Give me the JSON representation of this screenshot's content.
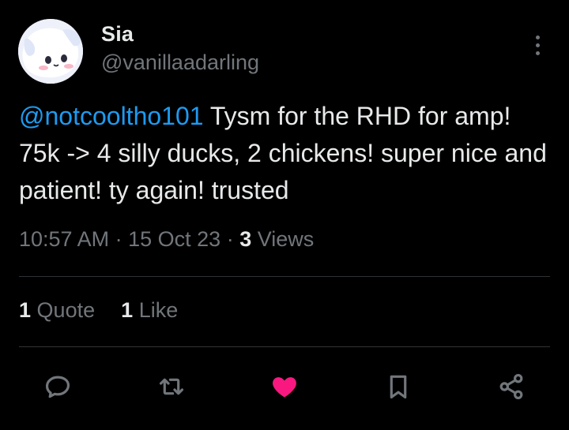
{
  "author": {
    "display_name": "Sia",
    "handle": "@vanillaadarling",
    "avatar_icon": "cinnamoroll-avatar"
  },
  "tweet": {
    "mention": "@notcooltho101",
    "text": " Tysm for the RHD for amp! 75k -> 4 silly ducks, 2 chickens! super nice and patient! ty again! trusted"
  },
  "meta": {
    "time": "10:57 AM",
    "date": "15 Oct 23",
    "separator": "·",
    "views_count": "3",
    "views_label": "Views"
  },
  "stats": {
    "quotes_count": "1",
    "quotes_label": "Quote",
    "likes_count": "1",
    "likes_label": "Like"
  },
  "actions": {
    "reply_icon": "reply-icon",
    "retweet_icon": "retweet-icon",
    "like_icon": "heart-icon",
    "bookmark_icon": "bookmark-icon",
    "share_icon": "share-icon"
  },
  "colors": {
    "background": "#000000",
    "text": "#e7e9ea",
    "muted": "#71767b",
    "link": "#1d9bf0",
    "liked": "#f91880",
    "divider": "#2f3336"
  }
}
